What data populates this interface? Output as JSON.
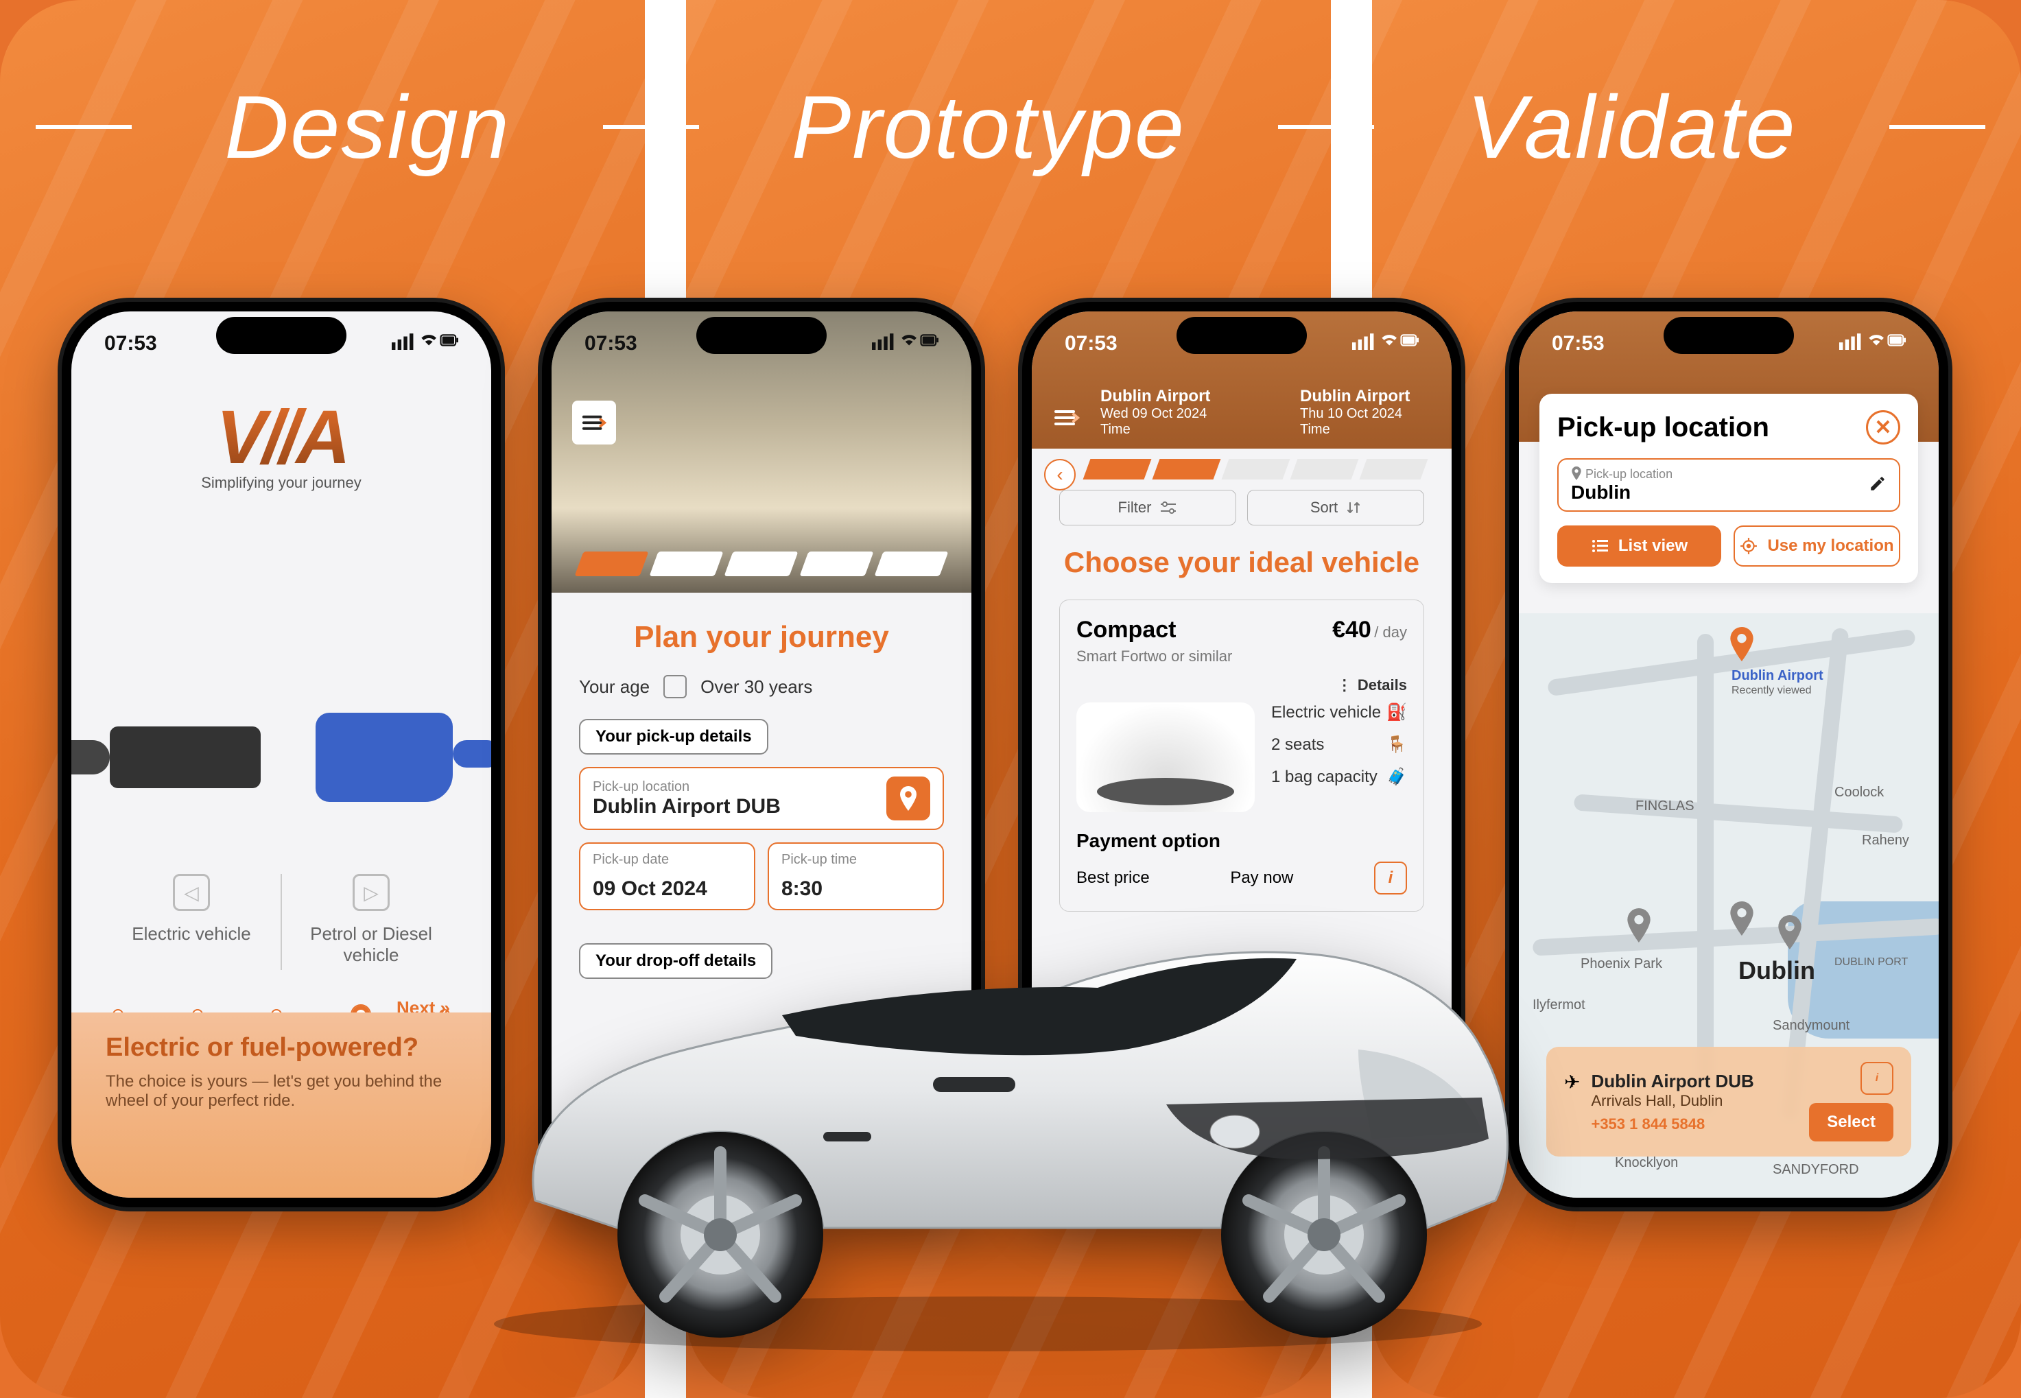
{
  "header": {
    "words": [
      "Design",
      "Prototype",
      "Validate"
    ]
  },
  "status": {
    "time": "07:53"
  },
  "brand": {
    "logo": "V//A",
    "tagline": "Simplifying your journey"
  },
  "screen1": {
    "options": {
      "left": "Electric vehicle",
      "right": "Petrol or Diesel vehicle"
    },
    "next": "Next »",
    "footer_title": "Electric or fuel-powered?",
    "footer_body": "The choice is yours — let's get you behind the wheel of your perfect ride."
  },
  "screen2": {
    "title": "Plan your journey",
    "age_label": "Your age",
    "age_value": "Over 30 years",
    "section_pickup": "Your pick-up details",
    "section_dropoff": "Your drop-off details",
    "pickup_loc_label": "Pick-up location",
    "pickup_loc_value": "Dublin Airport DUB",
    "pickup_date_label": "Pick-up date",
    "pickup_date_value": "09 Oct 2024",
    "pickup_time_label": "Pick-up time",
    "pickup_time_value": "8:30"
  },
  "screen3": {
    "from": {
      "name": "Dublin Airport",
      "date": "Wed 09 Oct 2024",
      "time_lbl": "Time"
    },
    "to": {
      "name": "Dublin Airport",
      "date": "Thu 10 Oct 2024",
      "time_lbl": "Time"
    },
    "filter": "Filter",
    "sort": "Sort",
    "title": "Choose your ideal vehicle",
    "vehicle": {
      "name": "Compact",
      "price": "€40",
      "price_suffix": "/ day",
      "sub": "Smart Fortwo or similar",
      "details": "Details",
      "specs": [
        "Electric vehicle",
        "2 seats",
        "1 bag capacity"
      ]
    },
    "payment_head": "Payment option",
    "pay_left": "Best price",
    "pay_right": "Pay now"
  },
  "screen4": {
    "title": "Pick-up location",
    "field_label": "Pick-up location",
    "field_value": "Dublin",
    "list_view": "List view",
    "use_location": "Use my location",
    "map_labels": {
      "airport": "Dublin Airport",
      "airport_sub": "Recently viewed",
      "finglas": "FINGLAS",
      "coolock": "Coolock",
      "raheny": "Raheny",
      "park": "Phoenix Park",
      "dublin": "Dublin",
      "port": "DUBLIN PORT",
      "sandymount": "Sandymount",
      "ilyfermot": "Ilyfermot",
      "knocklyon": "Knocklyon",
      "sandyford": "SANDYFORD"
    },
    "card": {
      "name": "Dublin Airport DUB",
      "addr": "Arrivals Hall, Dublin",
      "phone": "+353 1 844 5848",
      "select": "Select"
    }
  }
}
